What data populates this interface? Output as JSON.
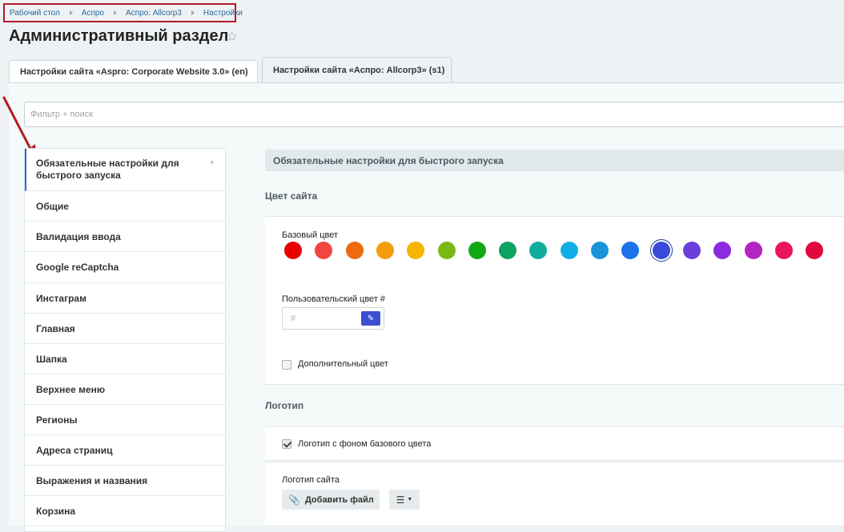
{
  "breadcrumb": [
    "Рабочий стол",
    "Аспро",
    "Аспро: Allcorp3",
    "Настройки"
  ],
  "page_title": "Административный раздел",
  "tabs": [
    {
      "label": "Настройки сайта «Aspro: Corporate Website 3.0» (en)"
    },
    {
      "label": "Настройки сайта «Аспро: Allcorp3» (s1)"
    }
  ],
  "filter": {
    "placeholder": "Фильтр + поиск",
    "value": ""
  },
  "sidebar": {
    "items": [
      "Обязательные настройки для быстрого запуска",
      "Общие",
      "Валидация ввода",
      "Google reCaptcha",
      "Инстаграм",
      "Главная",
      "Шапка",
      "Верхнее меню",
      "Регионы",
      "Адреса страниц",
      "Выражения и названия",
      "Корзина"
    ],
    "active_marker": "*"
  },
  "main": {
    "section_header": "Обязательные настройки для быстрого запуска",
    "site_color_title": "Цвет сайта",
    "base_color_label": "Базовый цвет",
    "swatch_colors": [
      "#e60000",
      "#f1463f",
      "#ee6a10",
      "#f49b0c",
      "#f7b400",
      "#7cb813",
      "#10a914",
      "#0ea263",
      "#10ad9c",
      "#10aee4",
      "#1b92dc",
      "#1c72ea",
      "#3b4bd8",
      "#6a3fdc",
      "#8b2bdf",
      "#b324c3",
      "#e91560",
      "#e0083d"
    ],
    "selected_swatch_index": 12,
    "custom_color_label": "Пользовательский цвет #",
    "custom_color_placeholder": "#",
    "custom_color_value": "",
    "extra_color_label": "Дополнительный цвет",
    "extra_color_checked": false,
    "logo_title": "Логотип",
    "logo_bg_label": "Логотип с фоном базового цвета",
    "logo_bg_checked": true,
    "site_logo_label": "Логотип сайта",
    "add_file_label": "Добавить файл"
  },
  "colors": {
    "accent": "#2d6797",
    "highlight_border": "#b11a2a",
    "annotation_arrow": "#b51a21"
  }
}
